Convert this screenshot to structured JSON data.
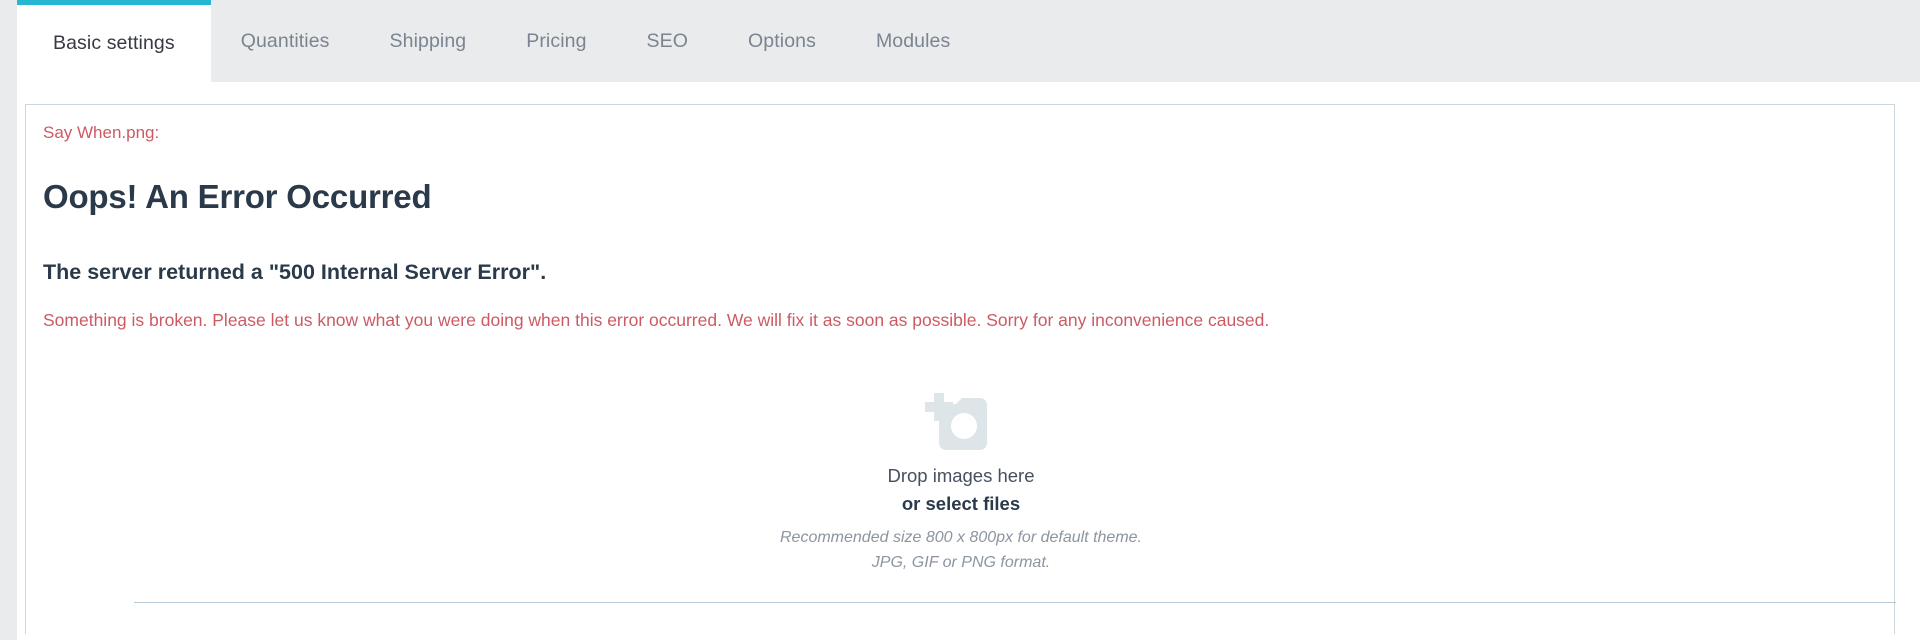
{
  "tabs": [
    {
      "label": "Basic settings",
      "active": true
    },
    {
      "label": "Quantities",
      "active": false
    },
    {
      "label": "Shipping",
      "active": false
    },
    {
      "label": "Pricing",
      "active": false
    },
    {
      "label": "SEO",
      "active": false
    },
    {
      "label": "Options",
      "active": false
    },
    {
      "label": "Modules",
      "active": false
    }
  ],
  "error": {
    "file_label": "Say When.png:",
    "title": "Oops! An Error Occurred",
    "subtitle": "The server returned a \"500 Internal Server Error\".",
    "body": "Something is broken. Please let us know what you were doing when this error occurred. We will fix it as soon as possible. Sorry for any inconvenience caused."
  },
  "dropzone": {
    "icon": "add-photo-icon",
    "drop_text": "Drop images here",
    "select_text": "or select files",
    "recommended_note": "Recommended size 800 x 800px for default theme.",
    "format_note": "JPG, GIF or PNG format."
  },
  "colors": {
    "accent": "#25b6d2",
    "error_text": "#cd5a63",
    "heading": "#2b3a4a",
    "tab_bar_bg": "#eaebec",
    "panel_border": "#cdd8de",
    "icon_fill": "#dde5e9",
    "rule": "#b9cbd7"
  }
}
